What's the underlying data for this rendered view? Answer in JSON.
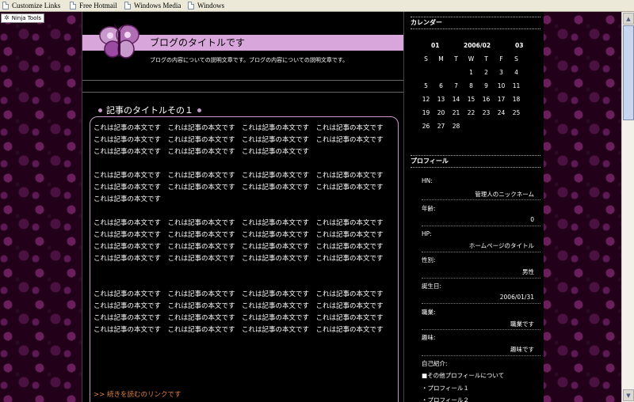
{
  "links_toolbar": {
    "items": [
      {
        "label": "Customize Links"
      },
      {
        "label": "Free Hotmail"
      },
      {
        "label": "Windows Media"
      },
      {
        "label": "Windows"
      }
    ]
  },
  "ninja_tools": {
    "label": "Ninja Tools"
  },
  "blog": {
    "title": "ブログのタイトルです",
    "description": "ブログの内容についての説明文章です。ブログの内容についての説明文章です。"
  },
  "entry": {
    "title": "記事のタイトルその１",
    "paragraphs": [
      "これは記事の本文です　これは記事の本文です　これは記事の本文です　これは記事の本文です　これは記事の本文です　これは記事の本文です　これは記事の本文です　これは記事の本文です　これは記事の本文です　これは記事の本文です　これは記事の本文です",
      "これは記事の本文です　これは記事の本文です　これは記事の本文です　これは記事の本文です　これは記事の本文です　これは記事の本文です　これは記事の本文です　これは記事の本文です　これは記事の本文です",
      "これは記事の本文です　これは記事の本文です　これは記事の本文です　これは記事の本文です　これは記事の本文です　これは記事の本文です　これは記事の本文です　これは記事の本文です　これは記事の本文です　これは記事の本文です　これは記事の本文です　これは記事の本文です　これは記事の本文です　これは記事の本文です　これは記事の本文です　これは記事の本文です",
      "これは記事の本文です　これは記事の本文です　これは記事の本文です　これは記事の本文です　これは記事の本文です　これは記事の本文です　これは記事の本文です　これは記事の本文です　これは記事の本文です　これは記事の本文です　これは記事の本文です　これは記事の本文です　これは記事の本文です　これは記事の本文です　これは記事の本文です　これは記事の本文です"
    ],
    "read_more": ">> 続きを読むのリンクです"
  },
  "calendar": {
    "heading": "カレンダー",
    "prev": "01",
    "current": "2006/02",
    "next": "03",
    "weekdays": [
      "S",
      "M",
      "T",
      "W",
      "T",
      "F",
      "S"
    ],
    "weeks": [
      [
        "",
        "",
        "",
        "1",
        "2",
        "3",
        "4"
      ],
      [
        "5",
        "6",
        "7",
        "8",
        "9",
        "10",
        "11"
      ],
      [
        "12",
        "13",
        "14",
        "15",
        "16",
        "17",
        "18"
      ],
      [
        "19",
        "20",
        "21",
        "22",
        "23",
        "24",
        "25"
      ],
      [
        "26",
        "27",
        "28",
        "",
        "",
        "",
        ""
      ]
    ]
  },
  "profile": {
    "heading": "プロフィール",
    "rows": [
      {
        "label": "HN:",
        "value": "管理人のニックネーム"
      },
      {
        "label": "年齢:",
        "value": "0"
      },
      {
        "label": "HP:",
        "value": "ホームページのタイトル"
      },
      {
        "label": "性別:",
        "value": "男性"
      },
      {
        "label": "誕生日:",
        "value": "2006/01/31"
      },
      {
        "label": "職業:",
        "value": "職業です"
      },
      {
        "label": "趣味:",
        "value": "趣味です"
      }
    ],
    "intro_label": "自己紹介:",
    "intro_lines": [
      "■その他プロフィールについて",
      "・プロフィール１",
      "・プロフィール２"
    ]
  },
  "colors": {
    "banner": "#d9a6dc",
    "accent": "#c89acb",
    "read_more": "#e08040"
  }
}
